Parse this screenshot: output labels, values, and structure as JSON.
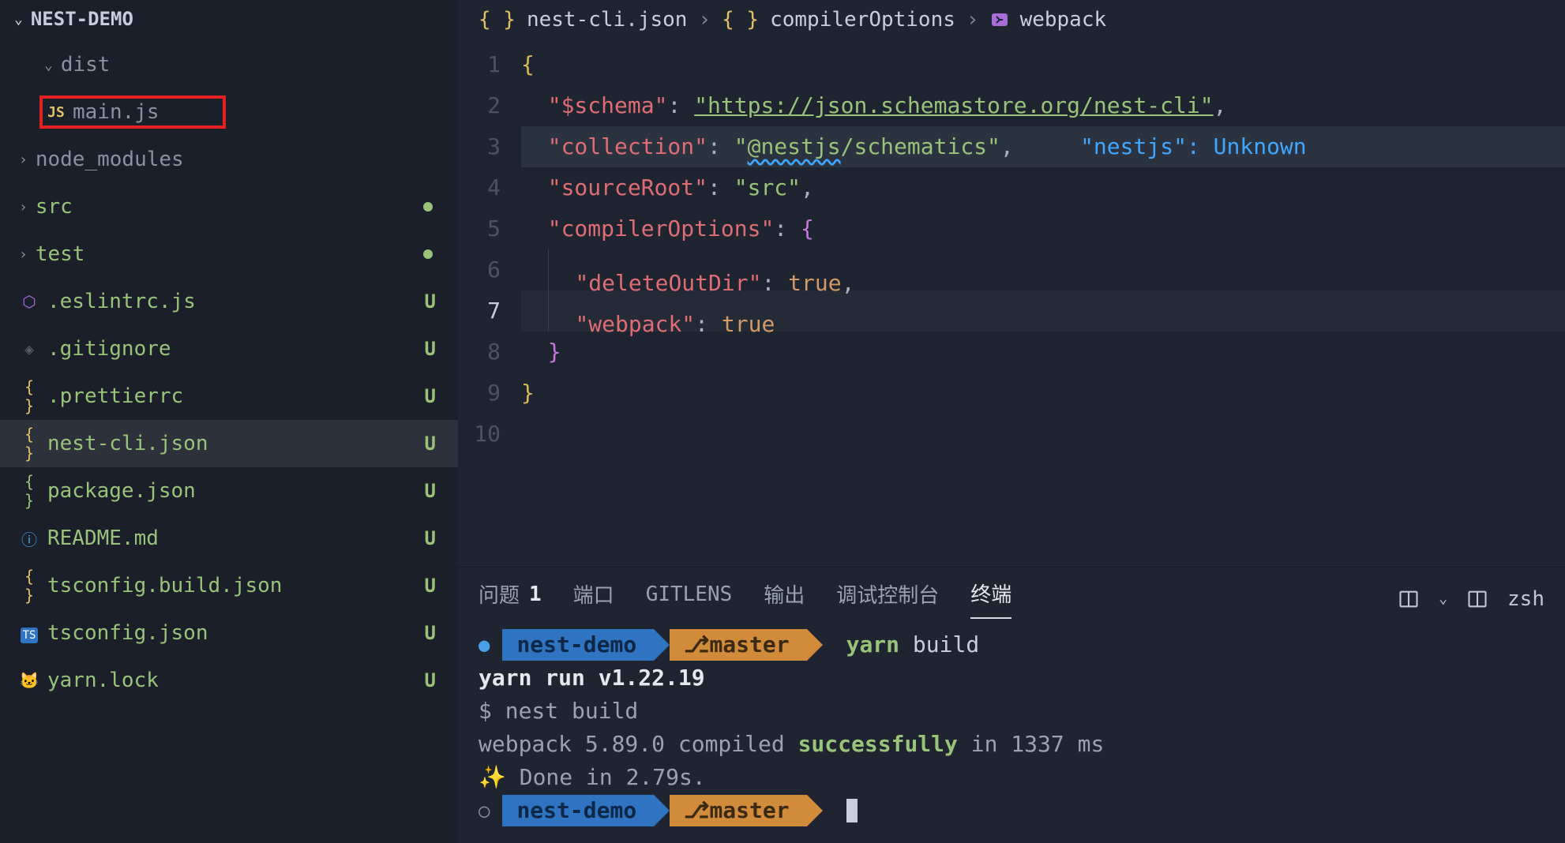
{
  "sidebar": {
    "project_name": "NEST-DEMO",
    "items": [
      {
        "type": "folder",
        "name": "dist",
        "icon": "chevron-down",
        "expanded": true
      },
      {
        "type": "file",
        "name": "main.js",
        "icon": "js",
        "highlighted": true,
        "depth": 1
      },
      {
        "type": "folder",
        "name": "node_modules",
        "icon": "chevron-right",
        "color": "grey"
      },
      {
        "type": "folder",
        "name": "src",
        "icon": "chevron-right",
        "color": "green",
        "dot": true
      },
      {
        "type": "folder",
        "name": "test",
        "icon": "chevron-right",
        "color": "green",
        "dot": true
      },
      {
        "type": "file",
        "name": ".eslintrc.js",
        "icon": "hex-purple",
        "status": "U"
      },
      {
        "type": "file",
        "name": ".gitignore",
        "icon": "git",
        "status": "U"
      },
      {
        "type": "file",
        "name": ".prettierrc",
        "icon": "json-y",
        "status": "U"
      },
      {
        "type": "file",
        "name": "nest-cli.json",
        "icon": "json-y",
        "status": "U",
        "active": true
      },
      {
        "type": "file",
        "name": "package.json",
        "icon": "json-g",
        "status": "U"
      },
      {
        "type": "file",
        "name": "README.md",
        "icon": "info",
        "status": "U"
      },
      {
        "type": "file",
        "name": "tsconfig.build.json",
        "icon": "json-y",
        "status": "U"
      },
      {
        "type": "file",
        "name": "tsconfig.json",
        "icon": "ts",
        "status": "U"
      },
      {
        "type": "file",
        "name": "yarn.lock",
        "icon": "yarn",
        "status": "U"
      }
    ]
  },
  "breadcrumb": {
    "parts": [
      "nest-cli.json",
      "compilerOptions",
      "webpack"
    ]
  },
  "editor": {
    "lines": [
      "1",
      "2",
      "3",
      "4",
      "5",
      "6",
      "7",
      "8",
      "9",
      "10"
    ],
    "active_line": "7",
    "json": {
      "$schema": "https://json.schemastore.org/nest-cli",
      "collection": "@nestjs/schematics",
      "sourceRoot": "src",
      "compilerOptions": {
        "deleteOutDir": true,
        "webpack": true
      }
    },
    "hint_key": "\"nestjs\"",
    "hint_val": "Unknown"
  },
  "panel": {
    "tabs": [
      "问题",
      "端口",
      "GITLENS",
      "输出",
      "调试控制台",
      "终端"
    ],
    "problems_count": "1",
    "active_tab": "终端",
    "actions_right": "zsh",
    "terminal": {
      "dir": "nest-demo",
      "branch": "master",
      "cmd_tool": "yarn",
      "cmd_arg": "build",
      "out1": "yarn run v1.22.19",
      "out2": "$ nest build",
      "out3_a": "webpack 5.89.0 compiled ",
      "out3_b": "successfully",
      "out3_c": " in 1337 ms",
      "out4": "✨  Done in 2.79s."
    }
  }
}
